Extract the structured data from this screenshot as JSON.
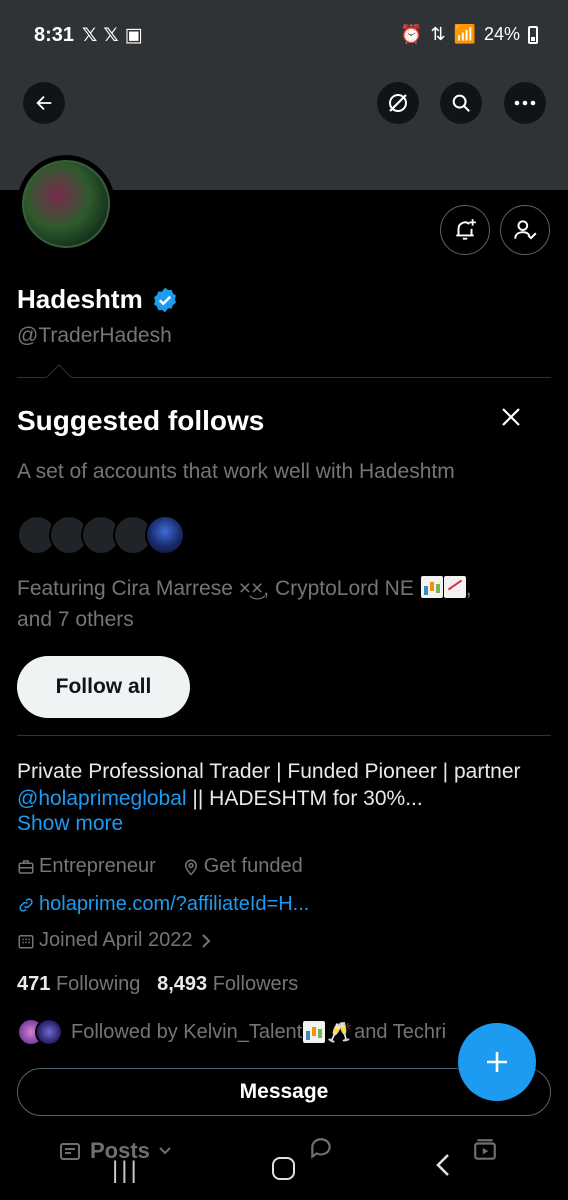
{
  "status_bar": {
    "time": "8:31",
    "left_icons": [
      "x-logo-icon",
      "x-logo-icon",
      "image-icon"
    ],
    "battery": "24%"
  },
  "header": {
    "back_icon": "back-arrow-icon",
    "grok_icon": "grok-icon",
    "search_icon": "search-icon",
    "more_icon": "more-horizontal-icon"
  },
  "profile": {
    "display_name": "Hadeshtm",
    "verified": true,
    "handle": "@TraderHadesh",
    "bio_text": "Private Professional Trader | Funded Pioneer | partner ",
    "bio_mention": "@holaprimeglobal",
    "bio_tail": " || HADESHTM for 30%...",
    "show_more": "Show more",
    "category": "Entrepreneur",
    "location": "Get funded",
    "website": "holaprime.com/?affiliateId=H...",
    "joined": "Joined April 2022",
    "following_count": "471",
    "following_label": "Following",
    "followers_count": "8,493",
    "followers_label": "Followers",
    "followed_by_text": "Followed by Kelvin_Talent",
    "followed_by_tail": " and Techri",
    "message_button": "Message"
  },
  "suggested": {
    "title": "Suggested follows",
    "subtitle": "A set of accounts that work well with Hadeshtm",
    "featuring_prefix": "Featuring Cira Marrese ",
    "featuring_emoji1": "×͜×",
    "featuring_mid": ", CryptoLord NE ",
    "featuring_suffix": ",",
    "featuring_line2": "and 7 others",
    "follow_all": "Follow all"
  },
  "tabs": {
    "posts": "Posts"
  },
  "colors": {
    "accent": "#1d9bf0",
    "background": "#000000",
    "banner": "#2f3336",
    "muted_text": "#71767b"
  }
}
